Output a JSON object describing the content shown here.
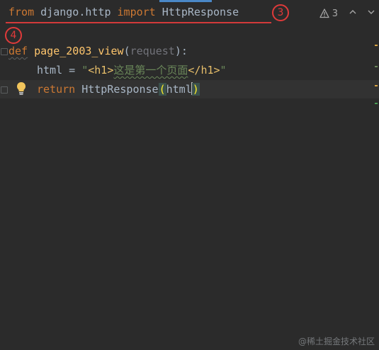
{
  "editor": {
    "line1": {
      "kw_from": "from",
      "module": " django.http ",
      "kw_import": "import",
      "name": " HttpResponse"
    },
    "line2": {
      "kw_def": "def",
      "space": " ",
      "func_name": "page_2003_view",
      "open_paren": "(",
      "param": "request",
      "close_paren": "):"
    },
    "line3": {
      "lhs": "html = ",
      "quote_open": "\"",
      "tag_open": "<h1>",
      "content": "这是第一个页面",
      "tag_close": "</h1>",
      "quote_close": "\""
    },
    "line4": {
      "kw_return": "return",
      "call": " HttpResponse",
      "open_paren": "(",
      "arg_before_cursor": "html",
      "arg_after_cursor": "",
      "close_paren": ")"
    }
  },
  "annotations": {
    "badge_3": "3",
    "badge_4": "4",
    "annotation_color": "#e03a3a"
  },
  "toolbar": {
    "warning_count": "3",
    "warning_icon": "warning-triangle-icon",
    "prev_icon": "chevron-up-icon",
    "next_icon": "chevron-down-icon"
  },
  "watermark": "@稀土掘金技术社区",
  "colors": {
    "background": "#2b2b2b",
    "keyword": "#cc7832",
    "function": "#ffc66d",
    "string": "#6a8759",
    "tag": "#e8bf6a",
    "default_text": "#a9b7c6"
  }
}
